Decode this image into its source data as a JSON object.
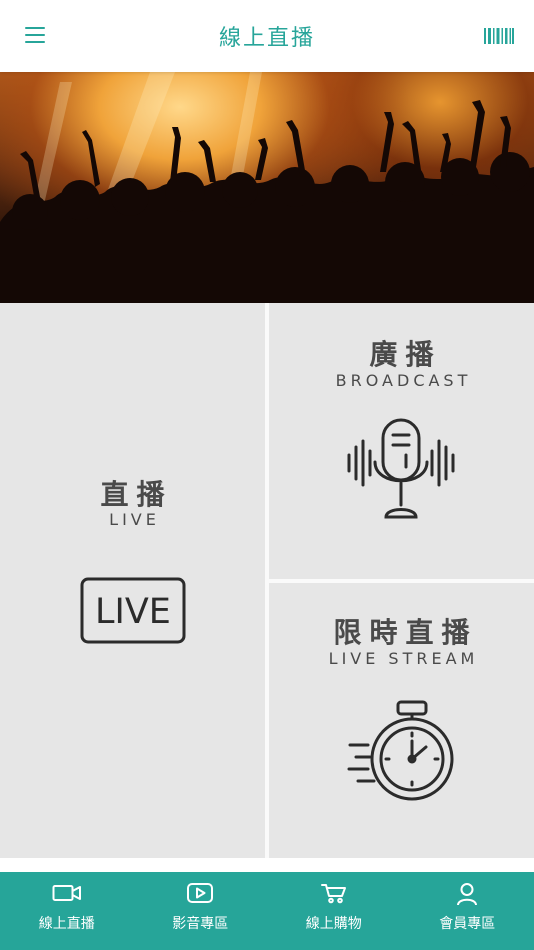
{
  "header": {
    "title": "線上直播",
    "menu_icon": "hamburger-menu-icon",
    "barcode_icon": "barcode-icon",
    "accent_color": "#27a59a"
  },
  "hero": {
    "image": "concert-crowd-photo"
  },
  "tiles": {
    "live": {
      "title": "直播",
      "subtitle": "LIVE",
      "badge_text": "LIVE",
      "icon": "live-badge-icon"
    },
    "broadcast": {
      "title": "廣播",
      "subtitle": "BROADCAST",
      "icon": "microphone-icon"
    },
    "stream": {
      "title": "限時直播",
      "subtitle": "LIVE STREAM",
      "icon": "stopwatch-icon"
    }
  },
  "bottom_nav": {
    "background": "#26a599",
    "items": [
      {
        "label": "線上直播",
        "icon": "video-camera-icon"
      },
      {
        "label": "影音專區",
        "icon": "play-icon"
      },
      {
        "label": "線上購物",
        "icon": "cart-icon"
      },
      {
        "label": "會員專區",
        "icon": "user-icon"
      }
    ]
  }
}
